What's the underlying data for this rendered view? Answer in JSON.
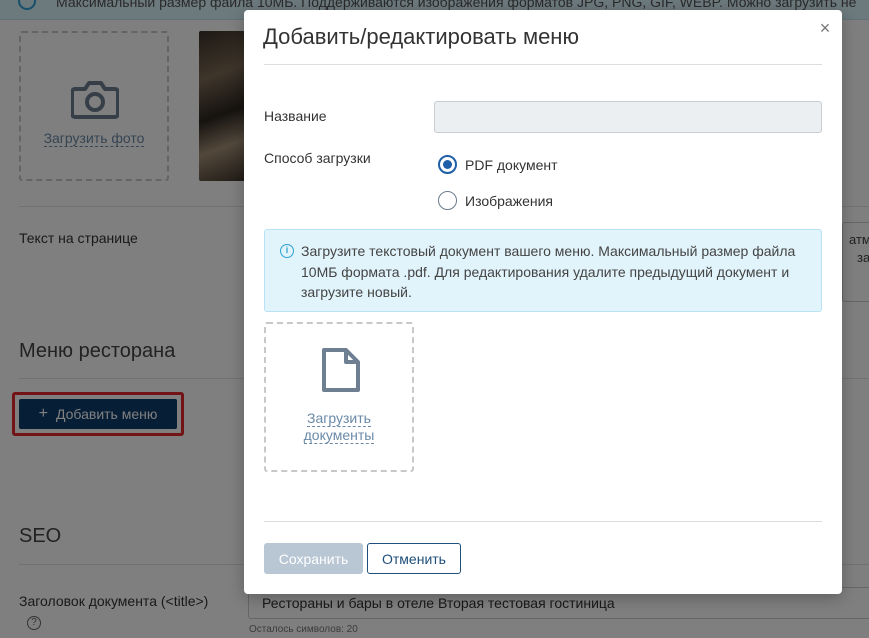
{
  "background": {
    "top_alert": "Максимальный размер файла 10МБ. Поддерживаются изображения форматов JPG, PNG, GIF, WEBP. Можно загрузить не",
    "photo_upload_label": "Загрузить фото",
    "page_text_label": "Текст на странице",
    "right_box_line1": "атмо",
    "right_box_line2": "за",
    "menu_section_title": "Меню ресторана",
    "add_menu_button": "Добавить меню",
    "seo_section_title": "SEO",
    "doc_title_label": "Заголовок документа (<title>)",
    "doc_title_value": "Рестораны и бары в отеле Вторая тестовая гостиница",
    "chars_left": "Осталось символов: 20",
    "help_icon_glyph": "?"
  },
  "modal": {
    "title": "Добавить/редактировать меню",
    "close_glyph": "×",
    "name_label": "Название",
    "name_value": "",
    "method_label": "Способ загрузки",
    "options": [
      {
        "label": "PDF документ",
        "selected": true
      },
      {
        "label": "Изображения",
        "selected": false
      }
    ],
    "info_icon_glyph": "i",
    "info_text": "Загрузите текстовый документ вашего меню. Максимальный размер файла 10МБ формата .pdf. Для редактирования удалите предыдущий документ и загрузите новый.",
    "upload_docs_line1": "Загрузить",
    "upload_docs_line2": "документы",
    "save_button": "Сохранить",
    "cancel_button": "Отменить"
  },
  "colors": {
    "primary": "#0e3d6e",
    "highlight_border": "#e8262a",
    "radio_selected": "#1f5fa8",
    "info_bg": "#e1f4fb",
    "save_disabled": "#b9c6d4"
  },
  "icons": {
    "photo": "camera-icon",
    "document": "document-icon",
    "info": "info-icon",
    "close": "close-icon",
    "plus": "plus-icon"
  }
}
